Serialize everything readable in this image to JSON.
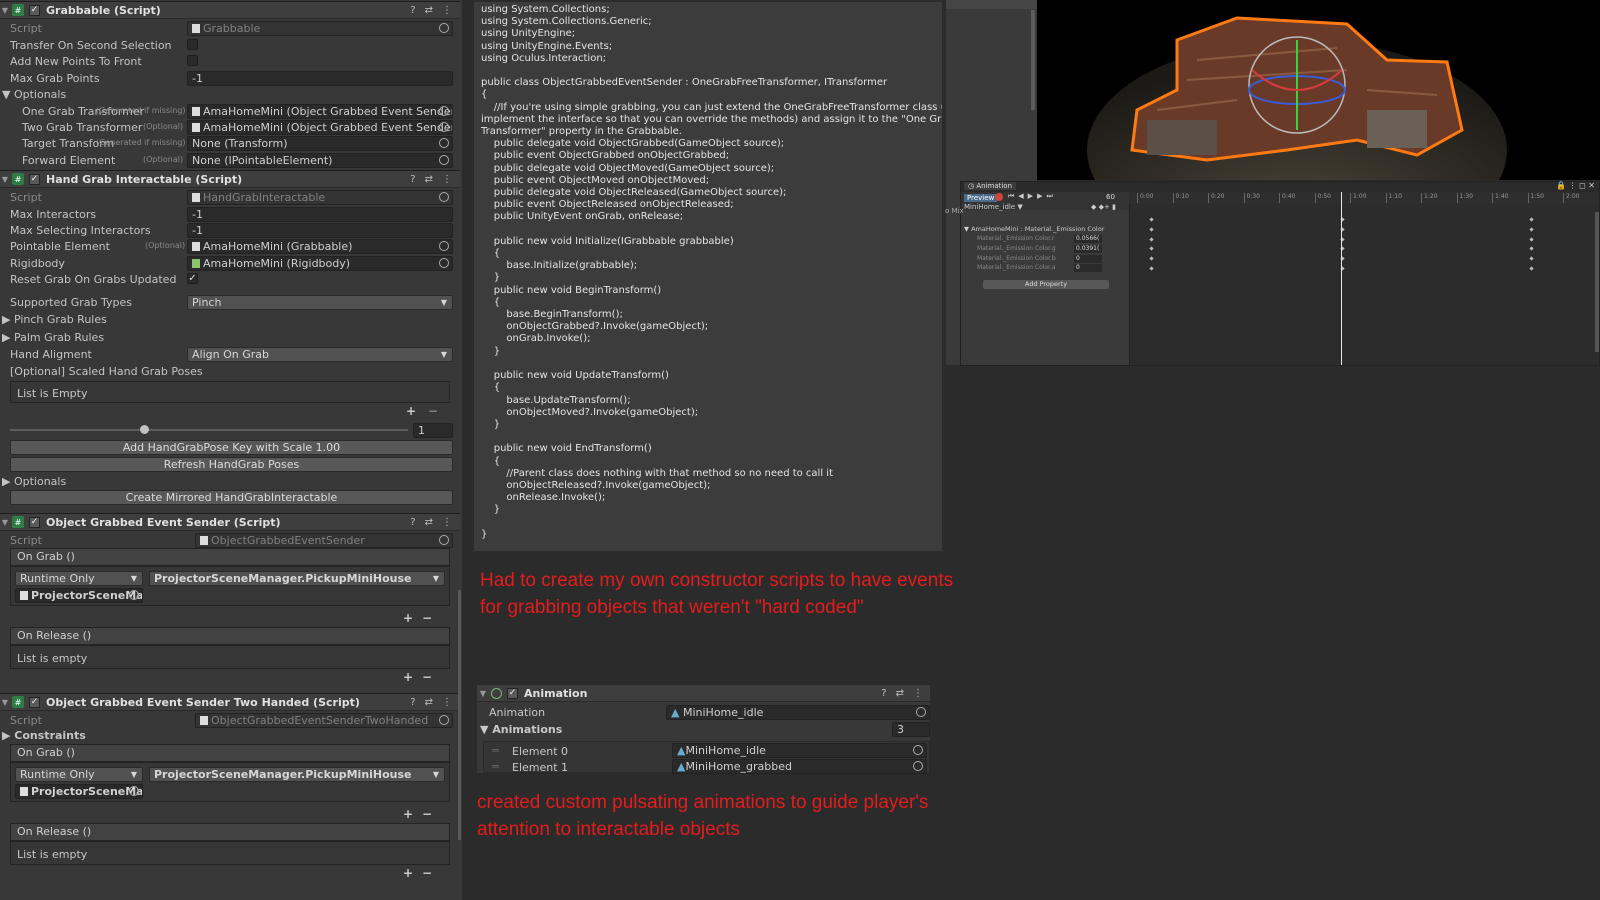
{
  "grabbable": {
    "title": "Grabbable (Script)",
    "script_label": "Script",
    "script_value": "Grabbable",
    "transfer_label": "Transfer On Second Selection",
    "addpts_label": "Add New Points To Front",
    "maxgrab_label": "Max Grab Points",
    "maxgrab_value": "-1",
    "optionals": "Optionals",
    "one_label": "One Grab Transformer",
    "one_hint": "(Generated if missing)",
    "one_value": "AmaHomeMini (Object Grabbed Event Sender)",
    "two_label": "Two Grab Transformer",
    "two_hint": "(Optional)",
    "two_value": "AmaHomeMini (Object Grabbed Event Sender Two H",
    "target_label": "Target Transform",
    "target_hint": "(Generated if missing)",
    "target_value": "None (Transform)",
    "fwd_label": "Forward Element",
    "fwd_hint": "(Optional)",
    "fwd_value": "None (IPointableElement)"
  },
  "hand": {
    "title": "Hand Grab Interactable (Script)",
    "script_label": "Script",
    "script_value": "HandGrabInteractable",
    "maxint_label": "Max Interactors",
    "maxint_value": "-1",
    "maxsel_label": "Max Selecting Interactors",
    "maxsel_value": "-1",
    "pe_label": "Pointable Element",
    "pe_hint": "(Optional)",
    "pe_value": "AmaHomeMini (Grabbable)",
    "rb_label": "Rigidbody",
    "rb_value": "AmaHomeMini (Rigidbody)",
    "reset_label": "Reset Grab On Grabs Updated",
    "check": "✓",
    "sgt_label": "Supported Grab Types",
    "sgt_value": "Pinch",
    "pinch_label": "Pinch Grab Rules",
    "palm_label": "Palm Grab Rules",
    "align_label": "Hand Aligment",
    "align_value": "Align On Grab",
    "scaled_label": "[Optional] Scaled Hand Grab Poses",
    "list_empty": "List is Empty",
    "slider_value": "1",
    "add_btn": "Add HandGrabPose Key with Scale 1.00",
    "refresh_btn": "Refresh HandGrab Poses",
    "optionals": "Optionals",
    "mirror_btn": "Create Mirrored HandGrabInteractable"
  },
  "sender": {
    "title": "Object Grabbed Event Sender (Script)",
    "script_label": "Script",
    "script_value": "ObjectGrabbedEventSender",
    "ongrab": "On Grab ()",
    "runtime": "Runtime Only",
    "method": "ProjectorSceneManager.PickupMiniHouse",
    "obj": "ProjectorSceneManac",
    "onrelease": "On Release ()",
    "list_empty": "List is empty"
  },
  "sender2": {
    "title": "Object Grabbed Event Sender Two Handed (Script)",
    "script_label": "Script",
    "script_value": "ObjectGrabbedEventSenderTwoHanded",
    "constraints": "Constraints",
    "ongrab": "On Grab ()",
    "runtime": "Runtime Only",
    "method": "ProjectorSceneManager.PickupMiniHouse",
    "obj": "ProjectorSceneManac",
    "onrelease": "On Release ()",
    "list_empty": "List is empty"
  },
  "code": "using System.Collections;\nusing System.Collections.Generic;\nusing UnityEngine;\nusing UnityEngine.Events;\nusing Oculus.Interaction;\n\npublic class ObjectGrabbedEventSender : OneGrabFreeTransformer, ITransformer\n{\n    //If you're using simple grabbing, you can just extend the OneGrabFreeTransformer class (and also\nimplement the interface so that you can override the methods) and assign it to the \"One Grab\nTransformer\" property in the Grabbable.\n    public delegate void ObjectGrabbed(GameObject source);\n    public event ObjectGrabbed onObjectGrabbed;\n    public delegate void ObjectMoved(GameObject source);\n    public event ObjectMoved onObjectMoved;\n    public delegate void ObjectReleased(GameObject source);\n    public event ObjectReleased onObjectReleased;\n    public UnityEvent onGrab, onRelease;\n\n    public new void Initialize(IGrabbable grabbable)\n    {\n        base.Initialize(grabbable);\n    }\n    public new void BeginTransform()\n    {\n        base.BeginTransform();\n        onObjectGrabbed?.Invoke(gameObject);\n        onGrab.Invoke();\n    }\n\n    public new void UpdateTransform()\n    {\n        base.UpdateTransform();\n        onObjectMoved?.Invoke(gameObject);\n    }\n\n    public new void EndTransform()\n    {\n        //Parent class does nothing with that method so no need to call it\n        onObjectReleased?.Invoke(gameObject);\n        onRelease.Invoke();\n    }\n\n}",
  "caption1": "Had to create my own constructor scripts to have events for grabbing objects that weren't \"hard coded\"",
  "caption2": "created custom pulsating animations to guide player's attention to interactable objects",
  "animcomp": {
    "title": "Animation",
    "anim_label": "Animation",
    "anim_value": "MiniHome_idle",
    "anims_label": "Animations",
    "anims_count": "3",
    "el0_label": "Element 0",
    "el0_value": "MiniHome_idle",
    "el1_label": "Element 1",
    "el1_value": "MiniHome_grabbed"
  },
  "animwin": {
    "tab": "Animation",
    "preview": "Preview",
    "frame": "60",
    "clip": "MiniHome_idle",
    "mix": "o Mix",
    "track": "AmaHomeMini : Material._Emission Color",
    "props": [
      {
        "name": "Material._Emission Color.r",
        "value": "0.0566("
      },
      {
        "name": "Material._Emission Color.g",
        "value": "0.0391("
      },
      {
        "name": "Material._Emission Color.b",
        "value": "0"
      },
      {
        "name": "Material._Emission Color.a",
        "value": "0"
      }
    ],
    "add_property": "Add Property",
    "ticks": [
      "0:00",
      "0:10",
      "0:20",
      "0:30",
      "0:40",
      "0:50",
      "1:00",
      "1:10",
      "1:20",
      "1:30",
      "1:40",
      "1:50",
      "2:00"
    ]
  }
}
